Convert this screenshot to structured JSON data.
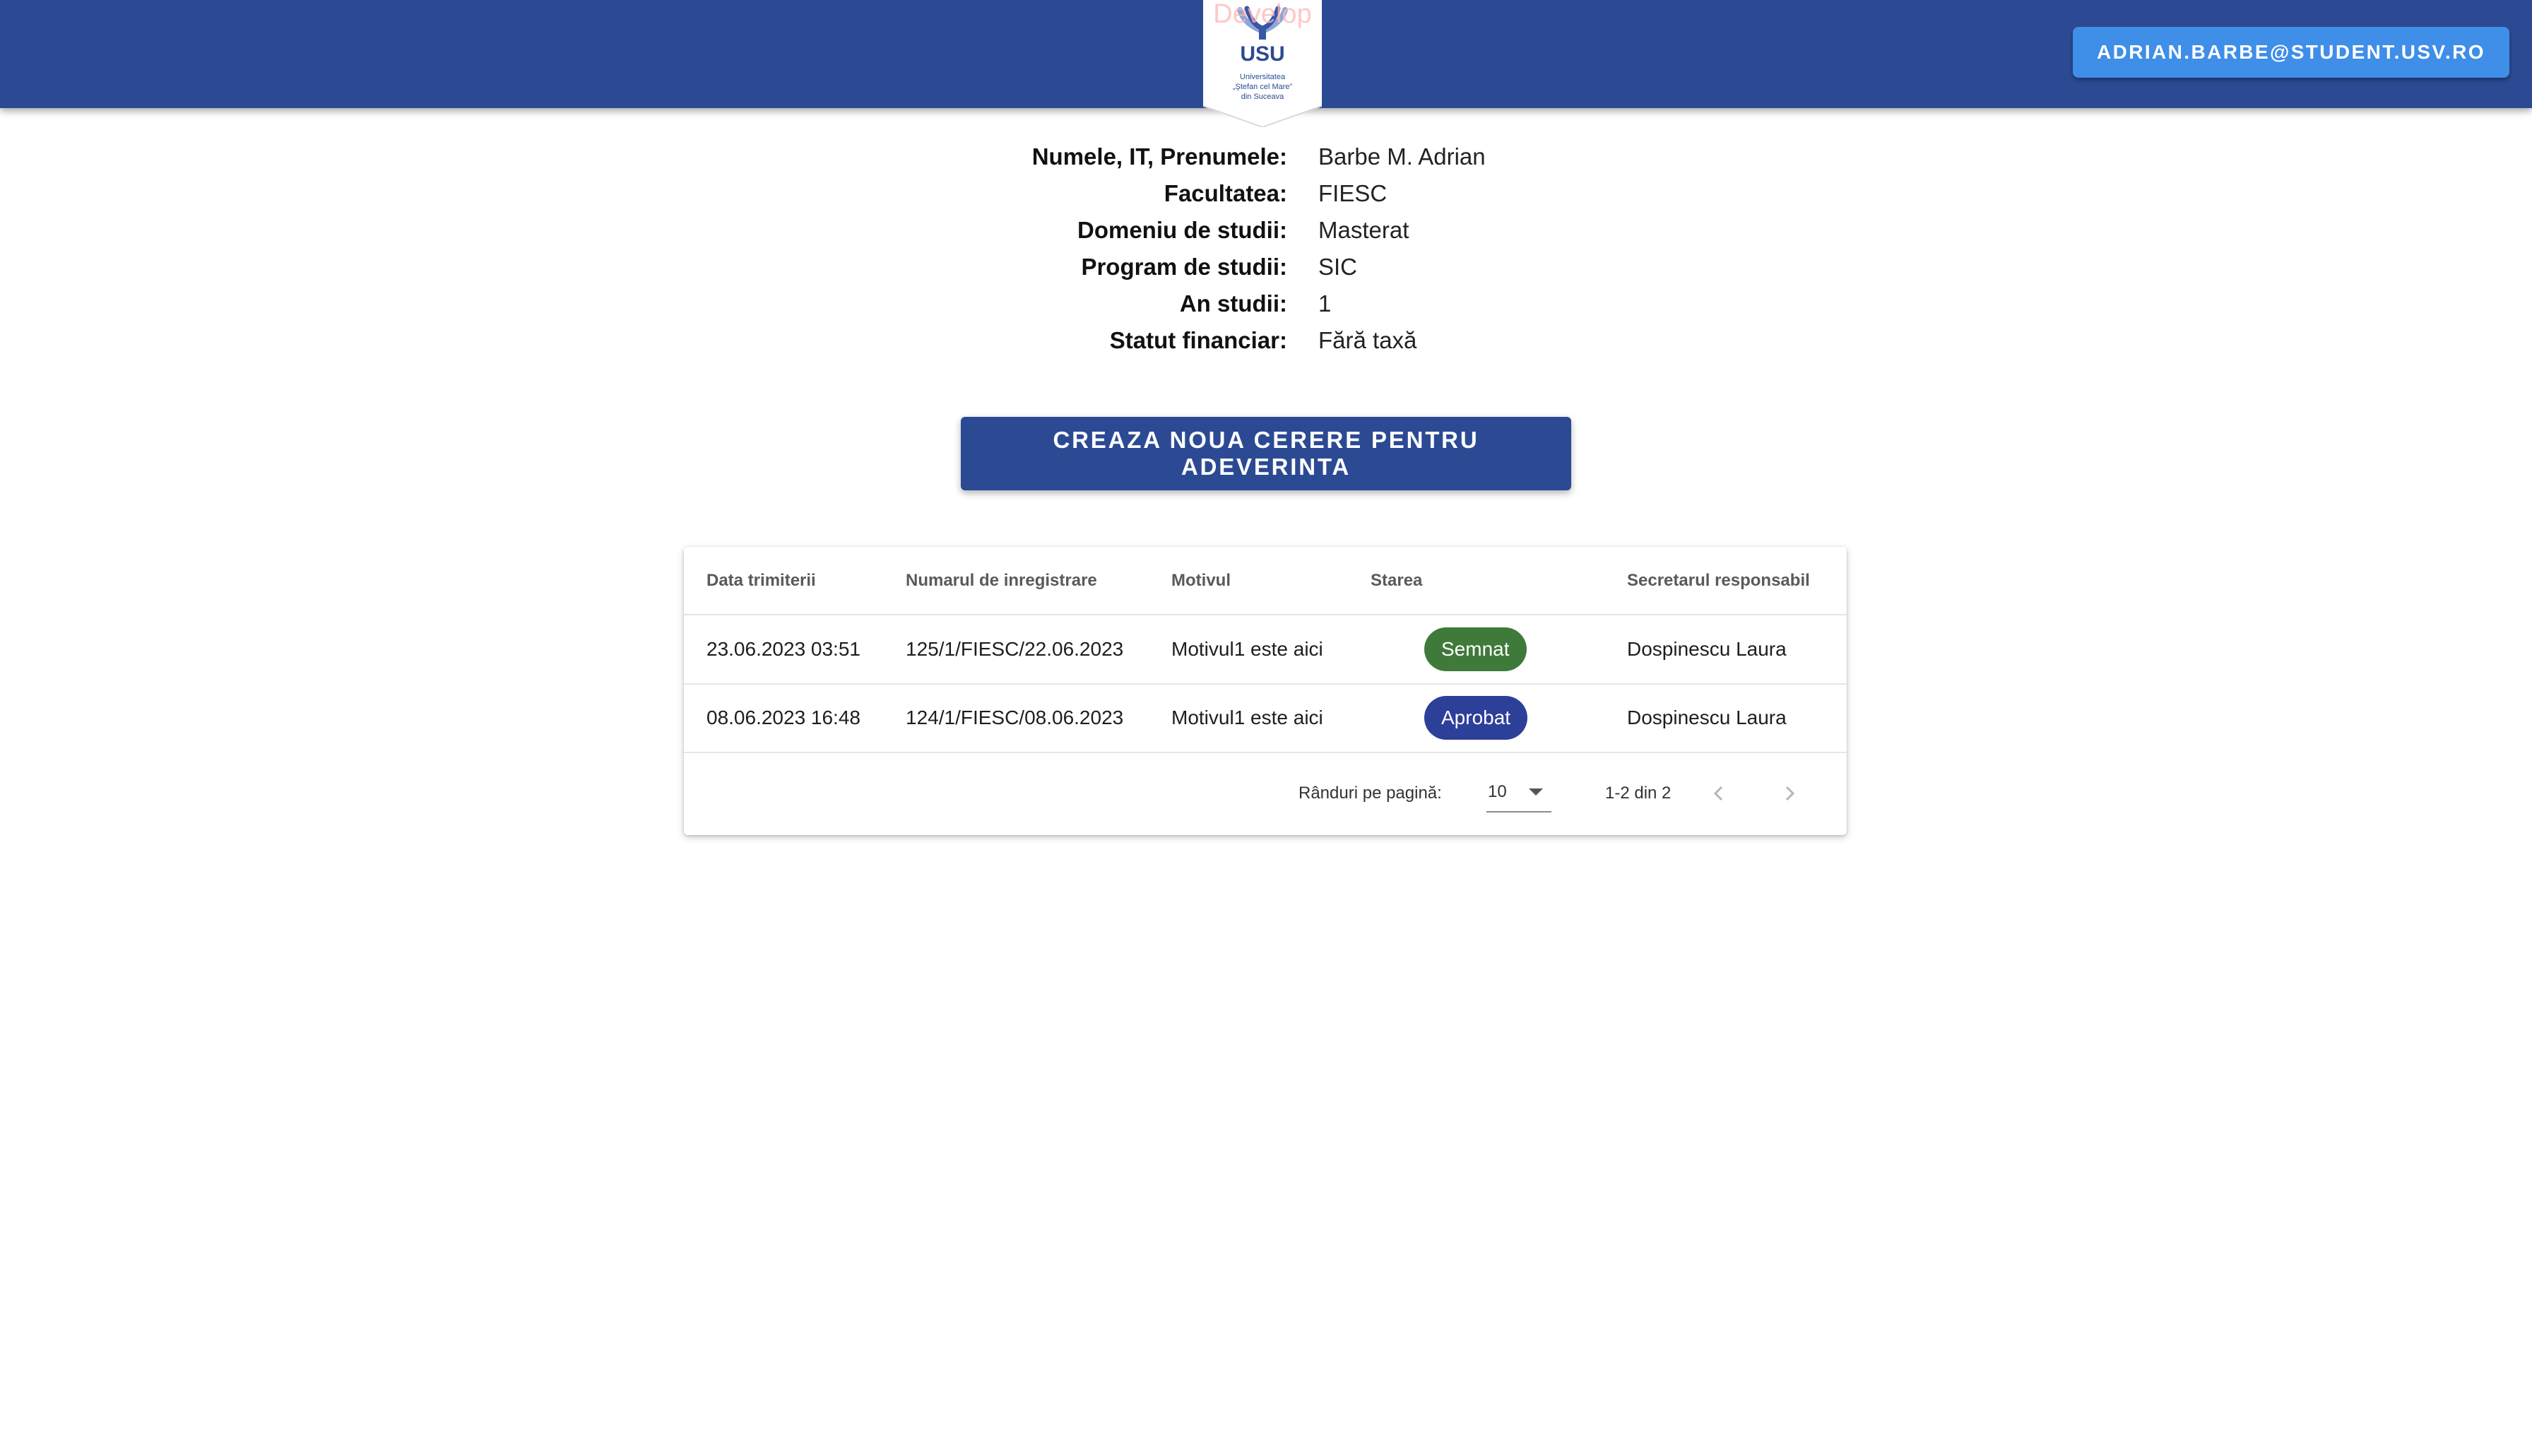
{
  "header": {
    "env_label": "Develop",
    "logo": {
      "acronym": "USU",
      "name_lines": [
        "Universitatea",
        "„Ştefan cel Mare”",
        "din Suceava"
      ]
    },
    "user_email": "ADRIAN.BARBE@STUDENT.USV.RO"
  },
  "student_info": [
    {
      "label": "Numele, IT, Prenumele:",
      "value": "Barbe M. Adrian"
    },
    {
      "label": "Facultatea:",
      "value": "FIESC"
    },
    {
      "label": "Domeniu de studii:",
      "value": "Masterat"
    },
    {
      "label": "Program de studii:",
      "value": "SIC"
    },
    {
      "label": "An studii:",
      "value": "1"
    },
    {
      "label": "Statut financiar:",
      "value": "Fără taxă"
    }
  ],
  "create_button_label": "CREAZA NOUA CERERE PENTRU ADEVERINTA",
  "table": {
    "columns": [
      "Data trimiterii",
      "Numarul de inregistrare",
      "Motivul",
      "Starea",
      "Secretarul responsabil"
    ],
    "rows": [
      {
        "date": "23.06.2023 03:51",
        "number": "125/1/FIESC/22.06.2023",
        "reason": "Motivul1 este aici",
        "status": "Semnat",
        "status_color": "#3f7a3a",
        "secretary": "Dospinescu Laura"
      },
      {
        "date": "08.06.2023 16:48",
        "number": "124/1/FIESC/08.06.2023",
        "reason": "Motivul1 este aici",
        "status": "Aprobat",
        "status_color": "#2c3f99",
        "secretary": "Dospinescu Laura"
      }
    ]
  },
  "pagination": {
    "rows_per_page_label": "Rânduri pe pagină:",
    "rows_per_page_value": "10",
    "range_text": "1-2 din 2",
    "prev_icon": "chevron-left-icon",
    "next_icon": "chevron-right-icon"
  },
  "colors": {
    "primary": "#2c4a93",
    "user_button": "#3f8ee8"
  }
}
